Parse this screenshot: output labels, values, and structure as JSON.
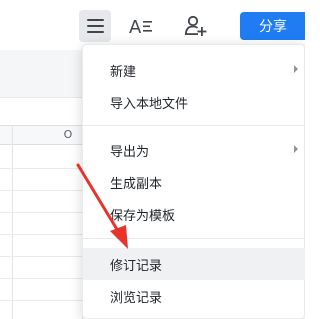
{
  "toolbar": {
    "menu_icon": "hamburger-menu-icon",
    "font_icon": "text-format-icon",
    "share_people_icon": "add-collaborator-icon",
    "share_label": "分享",
    "accent": "#1f7cf2"
  },
  "sheet": {
    "column_label": "O"
  },
  "menu": {
    "items": [
      {
        "label": "新建",
        "submenu": true
      },
      {
        "label": "导入本地文件",
        "submenu": false
      },
      {
        "label": "导出为",
        "submenu": true
      },
      {
        "label": "生成副本",
        "submenu": false
      },
      {
        "label": "保存为模板",
        "submenu": false
      },
      {
        "label": "修订记录",
        "submenu": false,
        "highlighted": true
      },
      {
        "label": "浏览记录",
        "submenu": false
      }
    ]
  },
  "annotation": {
    "arrow_color": "#e8332a"
  }
}
